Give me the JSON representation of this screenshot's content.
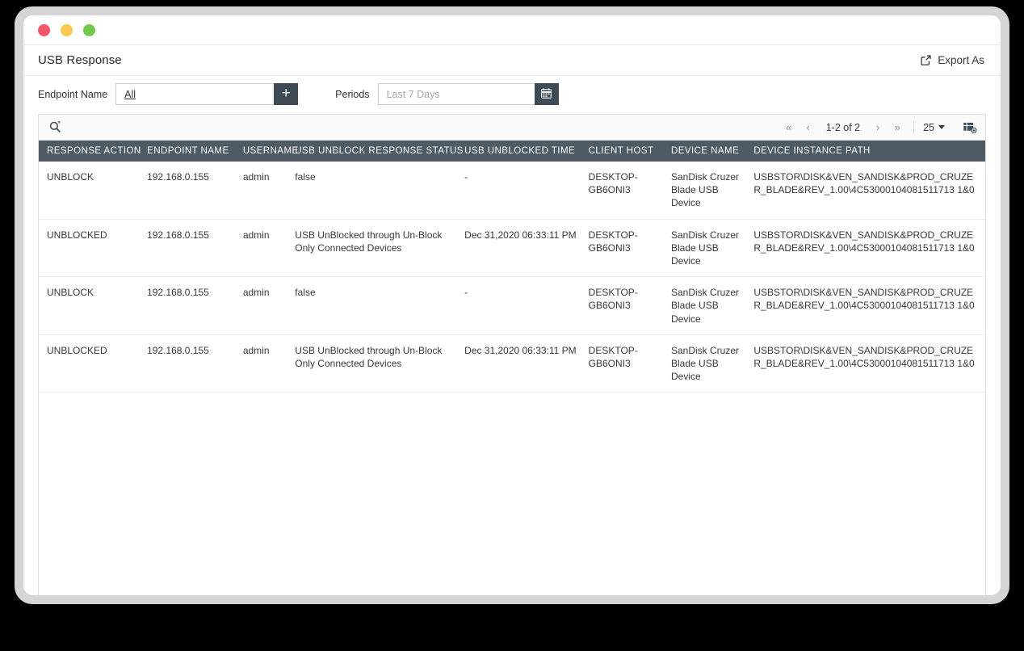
{
  "window": {
    "controls": [
      {
        "name": "close",
        "color": "#f5566a"
      },
      {
        "name": "minimize",
        "color": "#fac850"
      },
      {
        "name": "maximize",
        "color": "#6ec94c"
      }
    ]
  },
  "header": {
    "title": "USB Response",
    "export_label": "Export As",
    "export_icon": "external-link-icon"
  },
  "filters": {
    "endpoint": {
      "label": "Endpoint Name",
      "value": "All",
      "add_button_label": "+"
    },
    "periods": {
      "label": "Periods",
      "placeholder": "Last 7 Days",
      "calendar_icon": "calendar-icon"
    }
  },
  "toolbar": {
    "search_icon": "search-icon",
    "pager": {
      "first": "«",
      "prev": "‹",
      "range": "1-2 of 2",
      "next": "›",
      "last": "»"
    },
    "page_size": "25",
    "column_config_icon": "column-settings-icon"
  },
  "table": {
    "columns": [
      "RESPONSE ACTION",
      "ENDPOINT NAME",
      "USERNAME",
      "USB UNBLOCK RESPONSE STATUS",
      "USB UNBLOCKED TIME",
      "CLIENT HOST",
      "DEVICE NAME",
      "DEVICE INSTANCE PATH"
    ],
    "rows": [
      {
        "response_action": "UNBLOCK",
        "action_state": "unblock",
        "endpoint_name": "192.168.0.155",
        "username": "admin",
        "status": "false",
        "unblocked_time": "-",
        "client_host": "DESKTOP-GB6ONI3",
        "device_name": "SanDisk Cruzer Blade USB Device",
        "device_instance_path": "USBSTOR\\DISK&VEN_SANDISK&PROD_CRUZER_BLADE&REV_1.00\\4C53000104081511713 1&0"
      },
      {
        "response_action": "UNBLOCKED",
        "action_state": "unblocked",
        "endpoint_name": "192.168.0.155",
        "username": "admin",
        "status": "USB UnBlocked through Un-Block Only Connected Devices",
        "unblocked_time": "Dec 31,2020 06:33:11 PM",
        "client_host": "DESKTOP-GB6ONI3",
        "device_name": "SanDisk Cruzer Blade USB Device",
        "device_instance_path": "USBSTOR\\DISK&VEN_SANDISK&PROD_CRUZER_BLADE&REV_1.00\\4C53000104081511713 1&0"
      },
      {
        "response_action": "UNBLOCK",
        "action_state": "unblock",
        "endpoint_name": "192.168.0.155",
        "username": "admin",
        "status": "false",
        "unblocked_time": "-",
        "client_host": "DESKTOP-GB6ONI3",
        "device_name": "SanDisk Cruzer Blade USB Device",
        "device_instance_path": "USBSTOR\\DISK&VEN_SANDISK&PROD_CRUZER_BLADE&REV_1.00\\4C53000104081511713 1&0"
      },
      {
        "response_action": "UNBLOCKED",
        "action_state": "unblocked",
        "endpoint_name": "192.168.0.155",
        "username": "admin",
        "status": "USB UnBlocked through Un-Block Only Connected Devices",
        "unblocked_time": "Dec 31,2020 06:33:11 PM",
        "client_host": "DESKTOP-GB6ONI3",
        "device_name": "SanDisk Cruzer Blade USB Device",
        "device_instance_path": "USBSTOR\\DISK&VEN_SANDISK&PROD_CRUZER_BLADE&REV_1.00\\4C53000104081511713 1&0"
      }
    ]
  },
  "colors": {
    "header_bg": "#4f5b64",
    "unblock": "#e8756b",
    "unblocked": "#5cb88f",
    "button_dark": "#3e4b55"
  }
}
